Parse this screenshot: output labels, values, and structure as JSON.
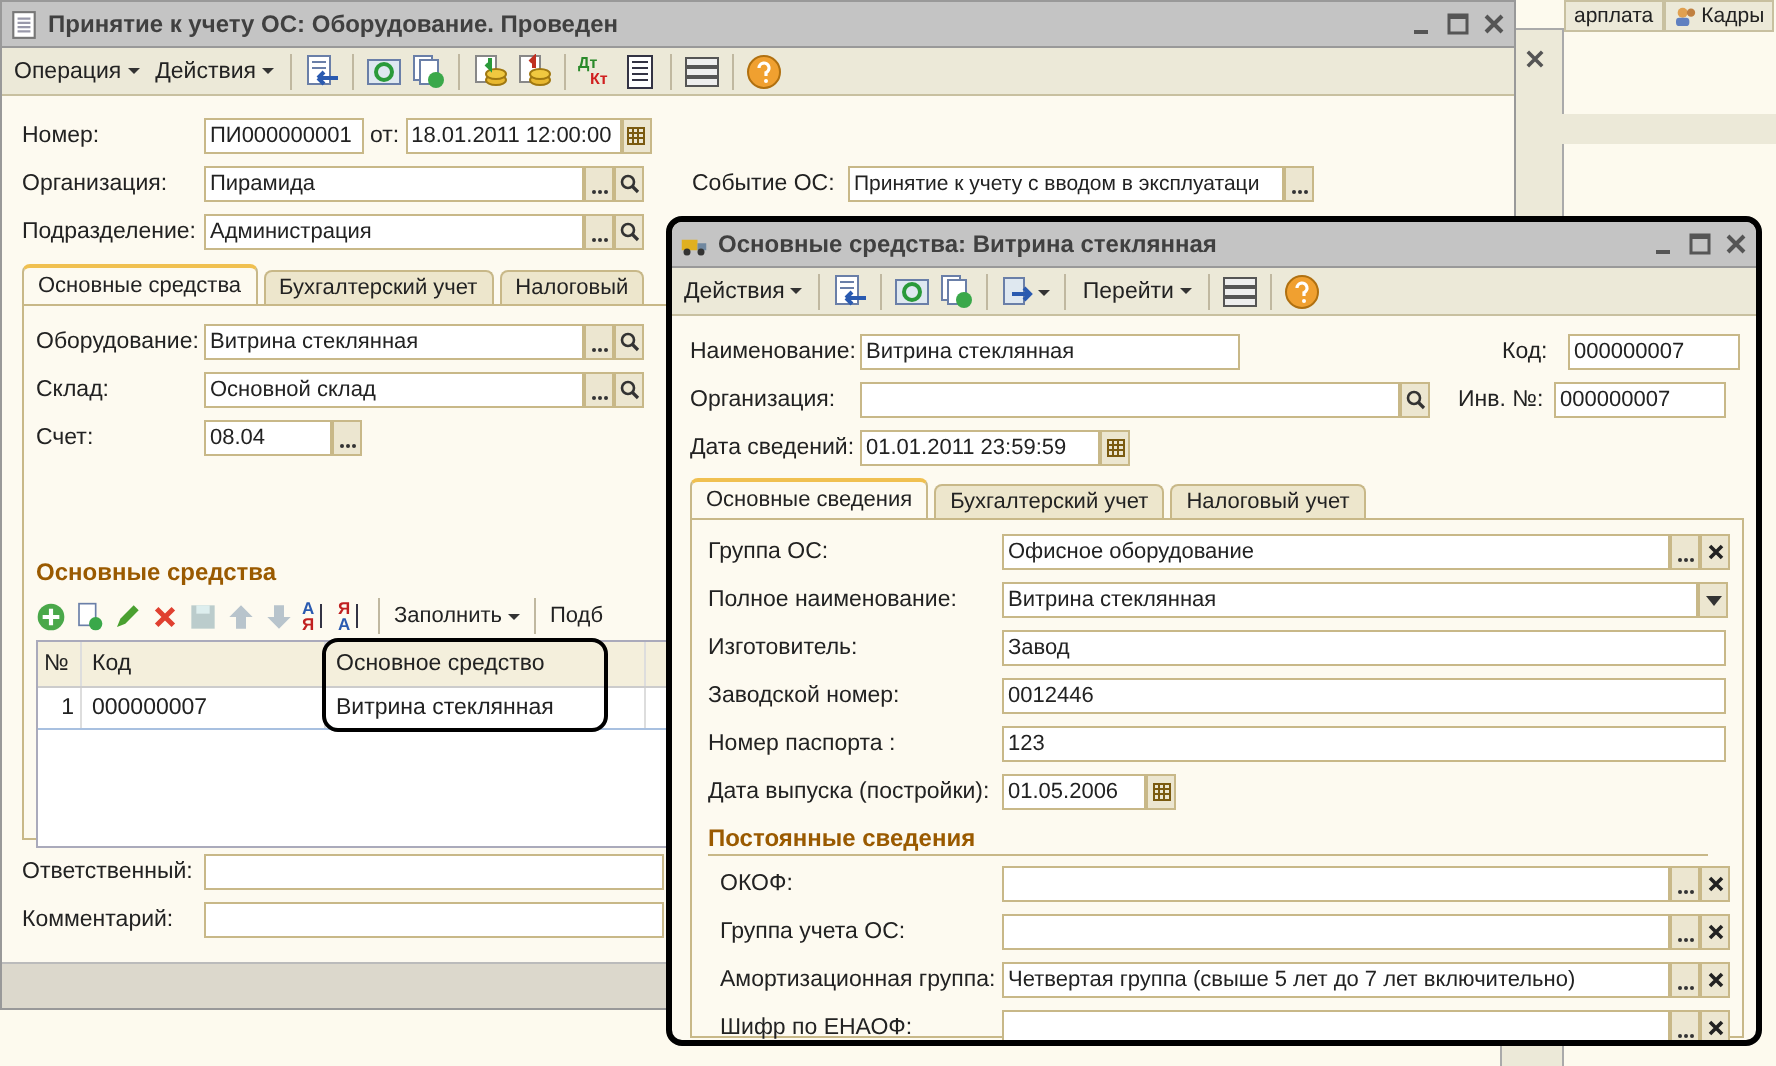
{
  "background_tabs": [
    {
      "label": "арплата"
    },
    {
      "label": "Кадры"
    }
  ],
  "document": {
    "title": "Принятие к учету ОС: Оборудование. Проведен",
    "menus": [
      "Операция",
      "Действия"
    ],
    "journal_icon": {
      "debit": "Дт",
      "credit": "Кт"
    },
    "number": {
      "label": "Номер:",
      "value": "ПИ000000001"
    },
    "date": {
      "label": "от:",
      "value": "18.01.2011 12:00:00"
    },
    "fields": [
      {
        "label": "Организация:",
        "value": "Пирамида",
        "kind": "choose_search"
      },
      {
        "label": "Подразделение:",
        "value": "Администрация",
        "kind": "choose_search"
      }
    ],
    "event": {
      "label": "Событие ОС:",
      "value": "Принятие к учету с вводом в эксплуатаци",
      "kind": "choose"
    },
    "tabs": [
      {
        "label": "Основные средства",
        "selected": true
      },
      {
        "label": "Бухгалтерский учет",
        "selected": false
      },
      {
        "label": "Налоговый",
        "selected": false
      }
    ],
    "tab_fields": [
      {
        "label": "Оборудование:",
        "value": "Витрина стеклянная",
        "kind": "choose_search"
      },
      {
        "label": "Склад:",
        "value": "Основной склад",
        "kind": "choose_search"
      },
      {
        "label": "Счет:",
        "value": "08.04",
        "kind": "short_choose"
      }
    ],
    "section_title": "Основные средства",
    "sort_icons": [
      {
        "top": "А",
        "bottom": "Я"
      },
      {
        "top": "Я",
        "bottom": "А"
      }
    ],
    "table_menus": [
      {
        "label": "Заполнить",
        "dropdown": true
      },
      {
        "label": "Подб",
        "dropdown": false
      }
    ],
    "table": {
      "columns": [
        "№",
        "Код",
        "Основное средство"
      ],
      "rows": [
        [
          "1",
          "000000007",
          "Витрина стеклянная"
        ]
      ]
    },
    "footer_fields": [
      {
        "label": "Ответственный:"
      },
      {
        "label": "Комментарий:"
      }
    ]
  },
  "card": {
    "title": "Основные средства: Витрина стеклянная",
    "actions_menu": "Действия",
    "goto_menu": "Перейти",
    "name": {
      "label": "Наименование:",
      "value": "Витрина стеклянная"
    },
    "code": {
      "label": "Код:",
      "value": "000000007"
    },
    "organization": {
      "label": "Организация:"
    },
    "inventory": {
      "label": "Инв. №:",
      "value": "000000007"
    },
    "info_date": {
      "label": "Дата сведений:",
      "value": "01.01.2011 23:59:59"
    },
    "tabs": [
      {
        "label": "Основные сведения",
        "selected": true
      },
      {
        "label": "Бухгалтерский учет",
        "selected": false
      },
      {
        "label": "Налоговый учет",
        "selected": false
      }
    ],
    "fields": [
      {
        "label": "Группа ОС:",
        "value": "Офисное оборудование",
        "kind": "choose_clear"
      },
      {
        "label": "Полное наименование:",
        "value": "Витрина стеклянная",
        "kind": "dropdown"
      },
      {
        "label": "Изготовитель:",
        "value": "Завод",
        "kind": "text"
      },
      {
        "label": "Заводской номер:",
        "value": "0012446",
        "kind": "text"
      },
      {
        "label": "Номер паспорта :",
        "value": "123",
        "kind": "text"
      },
      {
        "label": "Дата выпуска (постройки):",
        "value": "01.05.2006",
        "kind": "date"
      }
    ],
    "section_title": "Постоянные сведения",
    "constant_fields": [
      {
        "label": "ОКОФ:",
        "kind": "choose_clear"
      },
      {
        "label": "Группа учета ОС:",
        "kind": "choose_clear"
      },
      {
        "label": "Амортизационная группа:",
        "value": "Четвертая группа (свыше 5 лет до 7 лет включительно)",
        "kind": "choose_clear"
      },
      {
        "label": "Шифр по ЕНАОФ:",
        "kind": "choose_clear"
      }
    ]
  }
}
